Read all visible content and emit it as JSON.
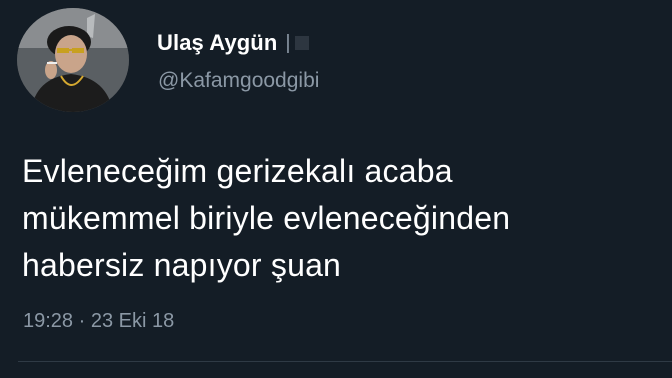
{
  "user": {
    "display_name": "Ulaş Aygün",
    "separator": "|",
    "username": "@Kafamgoodgibi",
    "avatar_icon": "profile-photo"
  },
  "tweet": {
    "lines": [
      "Evleneceğim gerizekalı acaba",
      "mükemmel biriyle evleneceğinden",
      "habersiz napıyor şuan"
    ],
    "time": "19:28 · 23 Eki 18"
  },
  "colors": {
    "background": "#141d26",
    "text_primary": "#ffffff",
    "text_secondary": "#8b98a5",
    "divider": "#2f3a45"
  }
}
